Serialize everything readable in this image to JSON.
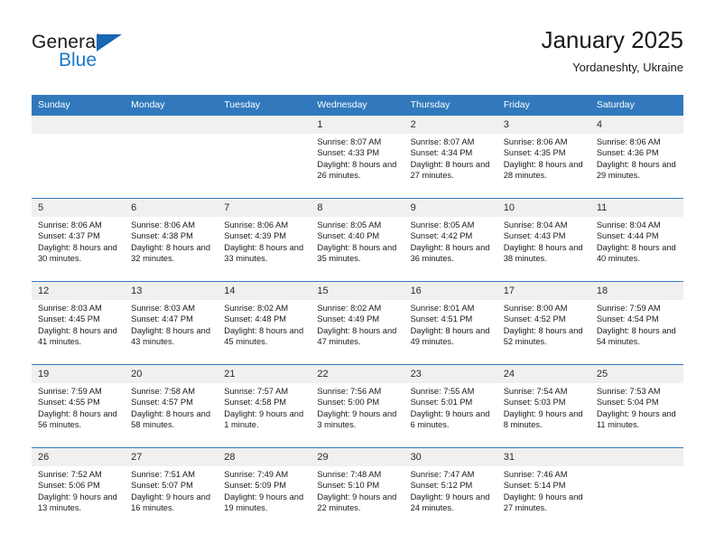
{
  "brand": {
    "name_top": "General",
    "name_bottom": "Blue",
    "accent_color": "#1879c9"
  },
  "header": {
    "title": "January 2025",
    "subtitle": "Yordaneshty, Ukraine"
  },
  "theme": {
    "header_blue": "#3179bc",
    "daynum_gray": "#f0f0f0",
    "text": "#1a1a1a"
  },
  "calendar": {
    "weekday_headers": [
      "Sunday",
      "Monday",
      "Tuesday",
      "Wednesday",
      "Thursday",
      "Friday",
      "Saturday"
    ],
    "labels": {
      "sunrise": "Sunrise:",
      "sunset": "Sunset:",
      "daylight": "Daylight:"
    },
    "weeks": [
      [
        {
          "day": "",
          "empty": true
        },
        {
          "day": "",
          "empty": true
        },
        {
          "day": "",
          "empty": true
        },
        {
          "day": "1",
          "sunrise": "Sunrise: 8:07 AM",
          "sunset": "Sunset: 4:33 PM",
          "daylight": "Daylight: 8 hours and 26 minutes."
        },
        {
          "day": "2",
          "sunrise": "Sunrise: 8:07 AM",
          "sunset": "Sunset: 4:34 PM",
          "daylight": "Daylight: 8 hours and 27 minutes."
        },
        {
          "day": "3",
          "sunrise": "Sunrise: 8:06 AM",
          "sunset": "Sunset: 4:35 PM",
          "daylight": "Daylight: 8 hours and 28 minutes."
        },
        {
          "day": "4",
          "sunrise": "Sunrise: 8:06 AM",
          "sunset": "Sunset: 4:36 PM",
          "daylight": "Daylight: 8 hours and 29 minutes."
        }
      ],
      [
        {
          "day": "5",
          "sunrise": "Sunrise: 8:06 AM",
          "sunset": "Sunset: 4:37 PM",
          "daylight": "Daylight: 8 hours and 30 minutes."
        },
        {
          "day": "6",
          "sunrise": "Sunrise: 8:06 AM",
          "sunset": "Sunset: 4:38 PM",
          "daylight": "Daylight: 8 hours and 32 minutes."
        },
        {
          "day": "7",
          "sunrise": "Sunrise: 8:06 AM",
          "sunset": "Sunset: 4:39 PM",
          "daylight": "Daylight: 8 hours and 33 minutes."
        },
        {
          "day": "8",
          "sunrise": "Sunrise: 8:05 AM",
          "sunset": "Sunset: 4:40 PM",
          "daylight": "Daylight: 8 hours and 35 minutes."
        },
        {
          "day": "9",
          "sunrise": "Sunrise: 8:05 AM",
          "sunset": "Sunset: 4:42 PM",
          "daylight": "Daylight: 8 hours and 36 minutes."
        },
        {
          "day": "10",
          "sunrise": "Sunrise: 8:04 AM",
          "sunset": "Sunset: 4:43 PM",
          "daylight": "Daylight: 8 hours and 38 minutes."
        },
        {
          "day": "11",
          "sunrise": "Sunrise: 8:04 AM",
          "sunset": "Sunset: 4:44 PM",
          "daylight": "Daylight: 8 hours and 40 minutes."
        }
      ],
      [
        {
          "day": "12",
          "sunrise": "Sunrise: 8:03 AM",
          "sunset": "Sunset: 4:45 PM",
          "daylight": "Daylight: 8 hours and 41 minutes."
        },
        {
          "day": "13",
          "sunrise": "Sunrise: 8:03 AM",
          "sunset": "Sunset: 4:47 PM",
          "daylight": "Daylight: 8 hours and 43 minutes."
        },
        {
          "day": "14",
          "sunrise": "Sunrise: 8:02 AM",
          "sunset": "Sunset: 4:48 PM",
          "daylight": "Daylight: 8 hours and 45 minutes."
        },
        {
          "day": "15",
          "sunrise": "Sunrise: 8:02 AM",
          "sunset": "Sunset: 4:49 PM",
          "daylight": "Daylight: 8 hours and 47 minutes."
        },
        {
          "day": "16",
          "sunrise": "Sunrise: 8:01 AM",
          "sunset": "Sunset: 4:51 PM",
          "daylight": "Daylight: 8 hours and 49 minutes."
        },
        {
          "day": "17",
          "sunrise": "Sunrise: 8:00 AM",
          "sunset": "Sunset: 4:52 PM",
          "daylight": "Daylight: 8 hours and 52 minutes."
        },
        {
          "day": "18",
          "sunrise": "Sunrise: 7:59 AM",
          "sunset": "Sunset: 4:54 PM",
          "daylight": "Daylight: 8 hours and 54 minutes."
        }
      ],
      [
        {
          "day": "19",
          "sunrise": "Sunrise: 7:59 AM",
          "sunset": "Sunset: 4:55 PM",
          "daylight": "Daylight: 8 hours and 56 minutes."
        },
        {
          "day": "20",
          "sunrise": "Sunrise: 7:58 AM",
          "sunset": "Sunset: 4:57 PM",
          "daylight": "Daylight: 8 hours and 58 minutes."
        },
        {
          "day": "21",
          "sunrise": "Sunrise: 7:57 AM",
          "sunset": "Sunset: 4:58 PM",
          "daylight": "Daylight: 9 hours and 1 minute."
        },
        {
          "day": "22",
          "sunrise": "Sunrise: 7:56 AM",
          "sunset": "Sunset: 5:00 PM",
          "daylight": "Daylight: 9 hours and 3 minutes."
        },
        {
          "day": "23",
          "sunrise": "Sunrise: 7:55 AM",
          "sunset": "Sunset: 5:01 PM",
          "daylight": "Daylight: 9 hours and 6 minutes."
        },
        {
          "day": "24",
          "sunrise": "Sunrise: 7:54 AM",
          "sunset": "Sunset: 5:03 PM",
          "daylight": "Daylight: 9 hours and 8 minutes."
        },
        {
          "day": "25",
          "sunrise": "Sunrise: 7:53 AM",
          "sunset": "Sunset: 5:04 PM",
          "daylight": "Daylight: 9 hours and 11 minutes."
        }
      ],
      [
        {
          "day": "26",
          "sunrise": "Sunrise: 7:52 AM",
          "sunset": "Sunset: 5:06 PM",
          "daylight": "Daylight: 9 hours and 13 minutes."
        },
        {
          "day": "27",
          "sunrise": "Sunrise: 7:51 AM",
          "sunset": "Sunset: 5:07 PM",
          "daylight": "Daylight: 9 hours and 16 minutes."
        },
        {
          "day": "28",
          "sunrise": "Sunrise: 7:49 AM",
          "sunset": "Sunset: 5:09 PM",
          "daylight": "Daylight: 9 hours and 19 minutes."
        },
        {
          "day": "29",
          "sunrise": "Sunrise: 7:48 AM",
          "sunset": "Sunset: 5:10 PM",
          "daylight": "Daylight: 9 hours and 22 minutes."
        },
        {
          "day": "30",
          "sunrise": "Sunrise: 7:47 AM",
          "sunset": "Sunset: 5:12 PM",
          "daylight": "Daylight: 9 hours and 24 minutes."
        },
        {
          "day": "31",
          "sunrise": "Sunrise: 7:46 AM",
          "sunset": "Sunset: 5:14 PM",
          "daylight": "Daylight: 9 hours and 27 minutes."
        },
        {
          "day": "",
          "empty": true
        }
      ]
    ]
  }
}
